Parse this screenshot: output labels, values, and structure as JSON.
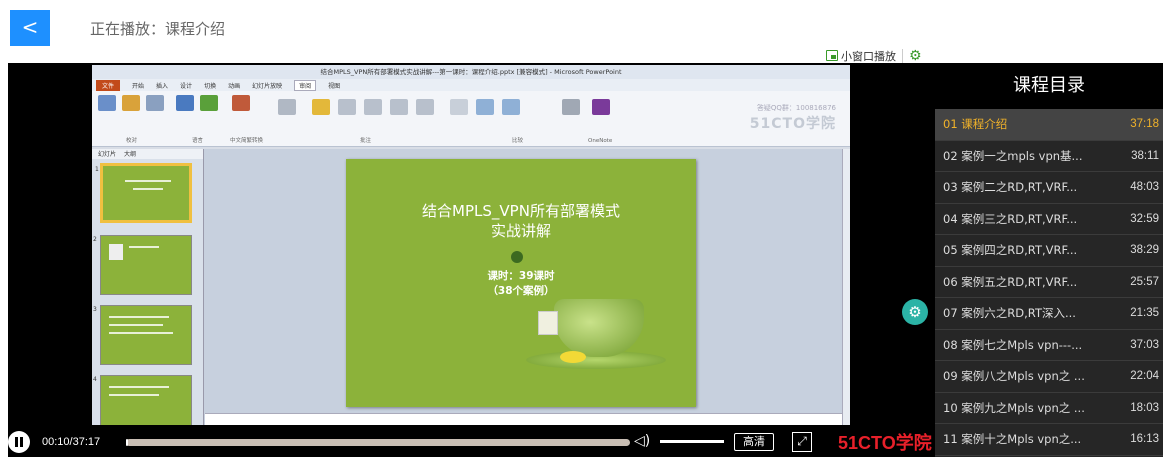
{
  "header": {
    "back_label": "<",
    "title": "正在播放：课程介绍"
  },
  "mini_bar": {
    "mini_window_label": "小窗口播放"
  },
  "video": {
    "ppt_window_title": "结合MPLS_VPN所有部署模式实战讲解---第一课时：课程介绍.pptx [兼容模式] - Microsoft PowerPoint",
    "ppt_tabs": [
      "文件",
      "开始",
      "插入",
      "设计",
      "切换",
      "动画",
      "幻灯片放映",
      "审阅",
      "视图"
    ],
    "ribbon_groups": [
      "校对",
      "语言",
      "中文简繁转换",
      "批注",
      "比较",
      "OneNote"
    ],
    "watermark_text": "答疑QQ群：100816876",
    "watermark_logo": "51CTO学院",
    "thumb_tabs": [
      "幻灯片",
      "大纲"
    ],
    "slide_title_line1": "结合MPLS_VPN所有部署模式",
    "slide_title_line2": "实战讲解",
    "slide_sub_line1": "课时：39课时",
    "slide_sub_line2": "（38个案例）"
  },
  "controls": {
    "time": "00:10/37:17",
    "progress": 0.0045,
    "hd_label": "高清",
    "brand": "51CTO学院"
  },
  "catalog": {
    "title": "课程目录",
    "items": [
      {
        "title": "01 课程介绍",
        "duration": "37:18",
        "active": true
      },
      {
        "title": "02 案例一之mpls vpn基...",
        "duration": "38:11"
      },
      {
        "title": "03 案例二之RD,RT,VRF...",
        "duration": "48:03"
      },
      {
        "title": "04 案例三之RD,RT,VRF...",
        "duration": "32:59"
      },
      {
        "title": "05 案例四之RD,RT,VRF...",
        "duration": "38:29"
      },
      {
        "title": "06 案例五之RD,RT,VRF...",
        "duration": "25:57"
      },
      {
        "title": "07 案例六之RD,RT深入...",
        "duration": "21:35"
      },
      {
        "title": "08 案例七之Mpls vpn---...",
        "duration": "37:03"
      },
      {
        "title": "09 案例八之Mpls vpn之 ...",
        "duration": "22:04"
      },
      {
        "title": "10 案例九之Mpls vpn之 ...",
        "duration": "18:03"
      },
      {
        "title": "11 案例十之Mpls vpn之...",
        "duration": "16:13"
      }
    ]
  }
}
